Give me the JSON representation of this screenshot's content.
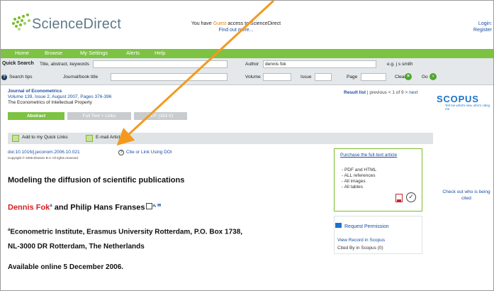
{
  "header": {
    "logo_text": "ScienceDirect",
    "guest_prefix": "You have ",
    "guest_word": "Guest",
    "guest_suffix": " access to ScienceDirect",
    "find_more": "Find out more...",
    "login": "Login: ",
    "register": "Register"
  },
  "nav": {
    "items": [
      "Home",
      "Browse",
      "My Settings",
      "Alerts",
      "Help"
    ]
  },
  "search": {
    "quick_search_label": "Quick Search",
    "field1_label": "Title, abstract, keywords",
    "author_label": "Author",
    "author_value": "dennis fok",
    "author_hint": "e.g. j s smith",
    "search_tips_label": "Search tips",
    "journal_label": "Journal/book title",
    "volume_label": "Volume",
    "issue_label": "Issue",
    "page_label": "Page",
    "clear_label": "Clear",
    "go_label": "Go"
  },
  "article": {
    "journal_title": "Journal of Econometrics",
    "volume_line": "Volume 139, Issue 2, August 2007, Pages 376-396",
    "book_title": "The Econometrics of Intellectual Property",
    "doi": "doi:10.1016/j.jeconom.2006.10.021",
    "copyright": "Copyright © 2006 Elsevier B.V. All rights reserved.",
    "cite_link": "Cite or Link Using DOI",
    "title": "Modeling the diffusion of scientific publications",
    "author1": "Dennis Fok",
    "author1_sup": "a",
    "and_text": " and Philip Hans Franses",
    "author2_sup": "a, ✉",
    "affiliation_line1": "Econometric Institute, Erasmus University Rotterdam, P.O. Box 1738,",
    "affiliation_line2": "NL-3000 DR Rotterdam, The Netherlands",
    "affiliation_sup": "a",
    "available": "Available online 5 December 2006."
  },
  "result_nav": {
    "result_list": "Result list",
    "sep": " | previous < 1 of 9 > ",
    "next": "next"
  },
  "tabs": [
    {
      "label": "Abstract",
      "active": true
    },
    {
      "label": "Full Text + Links",
      "active": false
    },
    {
      "label": "PDF (183 K)",
      "active": false
    }
  ],
  "tools": {
    "quick_links": "Add to my Quick Links",
    "email": "E-mail Article"
  },
  "purchase": {
    "title": "Purchase the full-text article",
    "items": [
      "- PDF and HTML",
      "- ALL references",
      "- All images",
      "- All tables"
    ]
  },
  "scopus": {
    "logo": "SCOPUS",
    "sub": "Tell me what's new, who's citing me"
  },
  "checkout": "Check out who is being cited",
  "permissions": {
    "request": "Request Permission",
    "view_record": "View Record in Scopus",
    "cited_by": "Cited By in Scopus (0)"
  },
  "colors": {
    "brand_green": "#7dc242",
    "link_blue": "#1a4ea0",
    "author_red": "#d21f1f",
    "arrow_orange": "#f39a1e",
    "scopus_blue": "#1b73c9"
  }
}
